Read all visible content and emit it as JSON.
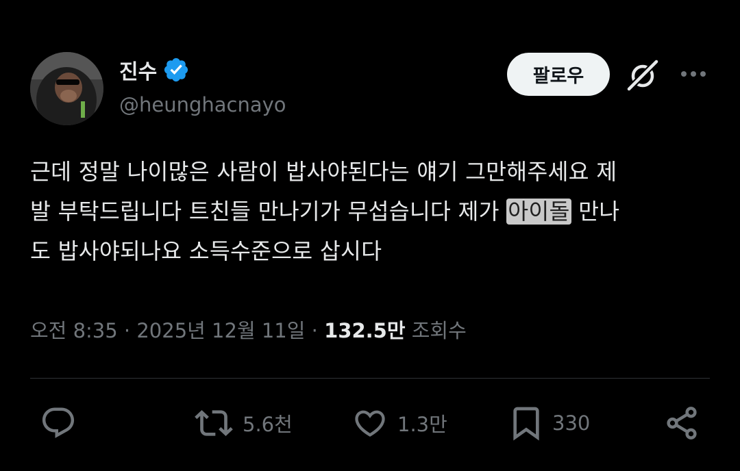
{
  "author": {
    "display_name": "진수",
    "handle": "@heunghacnayo",
    "verified": true,
    "avatar_icon": "avatar-gorilla-sunglasses"
  },
  "header": {
    "follow_label": "팔로우",
    "grok_icon": "grok-icon",
    "more_icon": "more-icon"
  },
  "tweet": {
    "line1": "근데 정말 나이많은 사람이 밥사야된다는 얘기 그만해주세요 제",
    "line2_a": "발 부탁드립니다 트친들 만나기가 무섭습니다 제가 ",
    "line2_highlight": "아이돌",
    "line2_b": " 만나",
    "line3": "도 밥사야되나요 소득수준으로 삽시다"
  },
  "meta": {
    "time": "오전 8:35",
    "date": "2025년 12월 11일",
    "sep": "·",
    "views_count": "132.5만",
    "views_label": "조회수"
  },
  "actions": {
    "reply_count": "",
    "retweet_count": "5.6천",
    "like_count": "1.3만",
    "bookmark_count": "330"
  },
  "colors": {
    "background": "#000000",
    "text": "#e7e9ea",
    "secondary": "#71767b",
    "verified": "#1d9bf0",
    "follow_bg": "#eff3f4",
    "divider": "#2f3336"
  }
}
